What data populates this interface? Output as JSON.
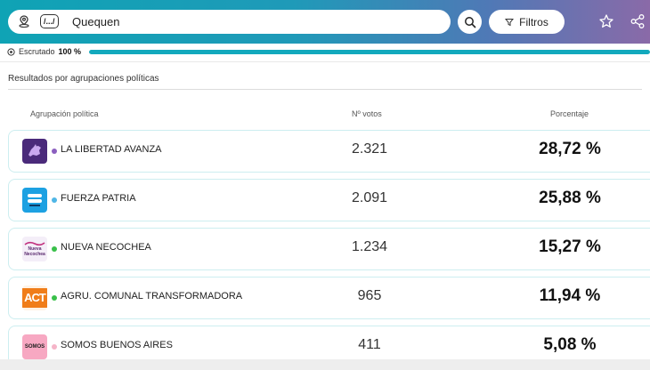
{
  "header": {
    "level_label": "/.../",
    "search_value": "Quequen",
    "filters_label": "Filtros"
  },
  "progress": {
    "label": "Escrutado",
    "value_text": "100 %",
    "fraction": 1.0,
    "color": "#12a9bd"
  },
  "section": {
    "title": "Resultados por agrupaciones políticas"
  },
  "table": {
    "col_party": "Agrupación política",
    "col_votes": "Nº votos",
    "col_pct": "Porcentaje",
    "rows": [
      {
        "name": "LA LIBERTAD AVANZA",
        "votes": "2.321",
        "pct": "28,72 %",
        "dot": "#8b5fbf",
        "logo_bg": "#4a2a7a",
        "icon": "lion-icon"
      },
      {
        "name": "FUERZA PATRIA",
        "votes": "2.091",
        "pct": "25,88 %",
        "dot": "#4fb6e6",
        "logo_bg": "#1da1e2",
        "icon": "flag-icon"
      },
      {
        "name": "NUEVA NECOCHEA",
        "votes": "1.234",
        "pct": "15,27 %",
        "dot": "#39c04a",
        "logo_bg": "#f4eef8",
        "icon": "nueva-necochea-logo",
        "logo_text_1": "Nueva",
        "logo_text_2": "Necochea"
      },
      {
        "name": "AGRU. COMUNAL TRANSFORMADORA",
        "votes": "965",
        "pct": "11,94 %",
        "dot": "#39c04a",
        "logo_bg": "#f07d19",
        "icon": "act-logo",
        "logo_text_1": "ACT"
      },
      {
        "name": "SOMOS BUENOS AIRES",
        "votes": "411",
        "pct": "5,08 %",
        "dot": "#f5b4c8",
        "logo_bg": "#f7a8c2",
        "icon": "somos-logo",
        "logo_text_1": "SOMOS"
      }
    ]
  }
}
